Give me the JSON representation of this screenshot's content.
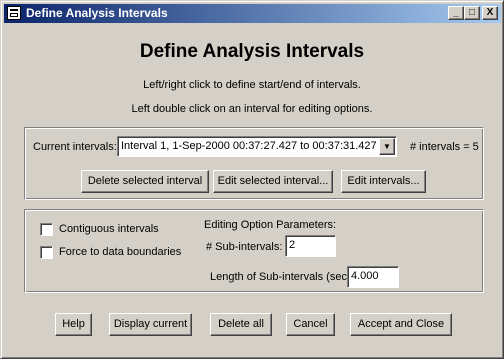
{
  "window": {
    "title": "Define Analysis Intervals",
    "minimize_glyph": "_",
    "maximize_glyph": "□",
    "close_glyph": "X"
  },
  "header": {
    "heading": "Define Analysis Intervals",
    "instruction_1": "Left/right click to define start/end of intervals.",
    "instruction_2": "Left double click on an interval for editing options."
  },
  "intervals": {
    "current_label": "Current intervals:",
    "selected_value": "Interval 1,   1-Sep-2000 00:37:27.427 to 00:37:31.427",
    "count_text": "# intervals = 5",
    "dropdown_glyph": "▼",
    "delete_selected_label": "Delete selected interval",
    "edit_selected_label": "Edit selected interval...",
    "edit_intervals_label": "Edit intervals..."
  },
  "options": {
    "contiguous_label": "Contiguous intervals",
    "force_label": "Force to data boundaries",
    "contiguous_checked": false,
    "force_checked": false,
    "params_heading": "Editing Option Parameters:",
    "subintervals_label": "# Sub-intervals:",
    "subintervals_value": "2",
    "length_label": "Length of Sub-intervals (sec):",
    "length_value": "4.000"
  },
  "footer": {
    "help_label": "Help",
    "display_current_label": "Display current",
    "delete_all_label": "Delete all",
    "cancel_label": "Cancel",
    "accept_close_label": "Accept and Close"
  },
  "colors": {
    "face": "#d4d0c8",
    "title_start": "#0a246a",
    "title_end": "#a6caf0"
  }
}
